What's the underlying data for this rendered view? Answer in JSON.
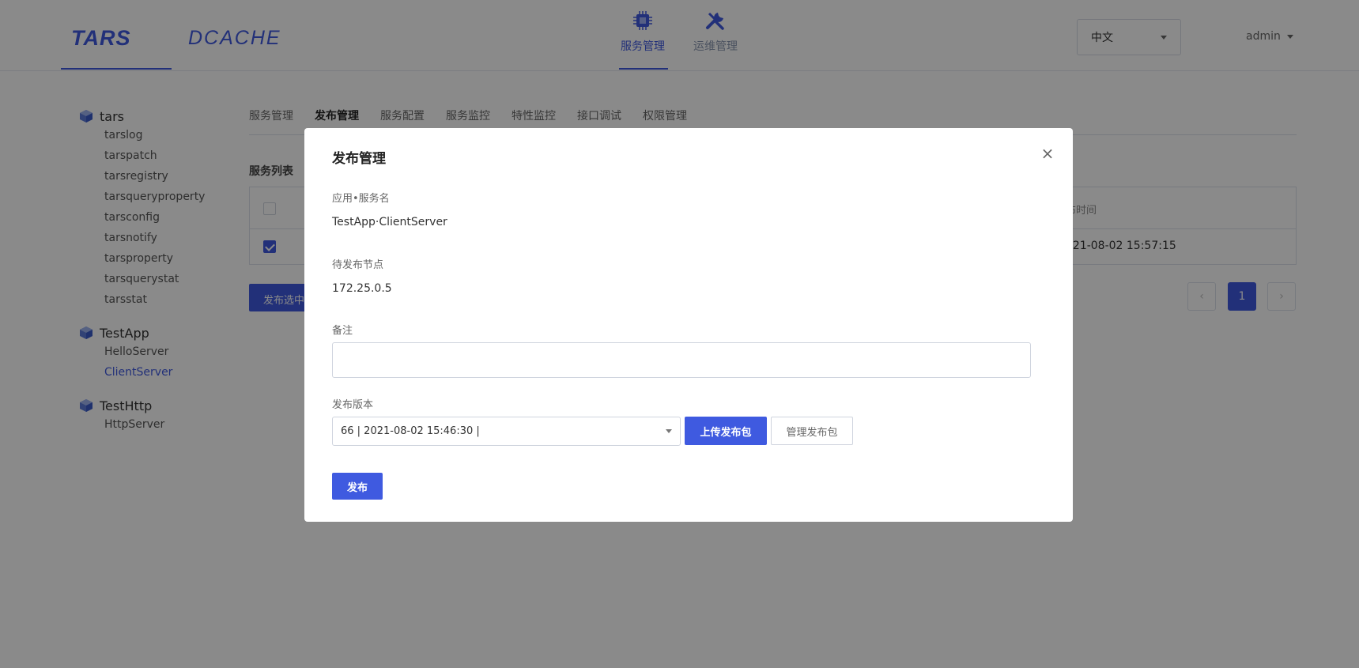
{
  "header": {
    "logos": [
      "TARS",
      "DCACHE"
    ],
    "nav": [
      {
        "label": "服务管理",
        "icon": "chip-icon",
        "active": true
      },
      {
        "label": "运维管理",
        "icon": "tools-icon",
        "active": false
      }
    ],
    "language": "中文",
    "user": "admin"
  },
  "sidebar": {
    "apps": [
      {
        "name": "tars",
        "servers": [
          "tarslog",
          "tarspatch",
          "tarsregistry",
          "tarsqueryproperty",
          "tarsconfig",
          "tarsnotify",
          "tarsproperty",
          "tarsquerystat",
          "tarsstat"
        ]
      },
      {
        "name": "TestApp",
        "servers": [
          "HelloServer",
          "ClientServer"
        ],
        "active_server": "ClientServer"
      },
      {
        "name": "TestHttp",
        "servers": [
          "HttpServer"
        ]
      }
    ]
  },
  "main": {
    "tabs": [
      "服务管理",
      "发布管理",
      "服务配置",
      "服务监控",
      "特性监控",
      "接口调试",
      "权限管理"
    ],
    "active_tab": "发布管理",
    "section_title": "服务列表",
    "table": {
      "time_header": "布时间",
      "row_time": "021-08-02 15:57:15"
    },
    "publish_selected_label": "发布选中",
    "pager": {
      "prev": "‹",
      "current": "1",
      "next": "›"
    }
  },
  "modal": {
    "title": "发布管理",
    "close": "×",
    "app_server_label": "应用•服务名",
    "app_server_value": "TestApp·ClientServer",
    "nodes_label": "待发布节点",
    "nodes_value": "172.25.0.5",
    "remark_label": "备注",
    "remark_value": "",
    "version_label": "发布版本",
    "version_value": "66 | 2021-08-02 15:46:30 |",
    "upload_label": "上传发布包",
    "manage_label": "管理发布包",
    "publish_label": "发布"
  },
  "colors": {
    "accent": "#3f5ae0",
    "overlay": "rgba(0,0,0,0.46)"
  }
}
